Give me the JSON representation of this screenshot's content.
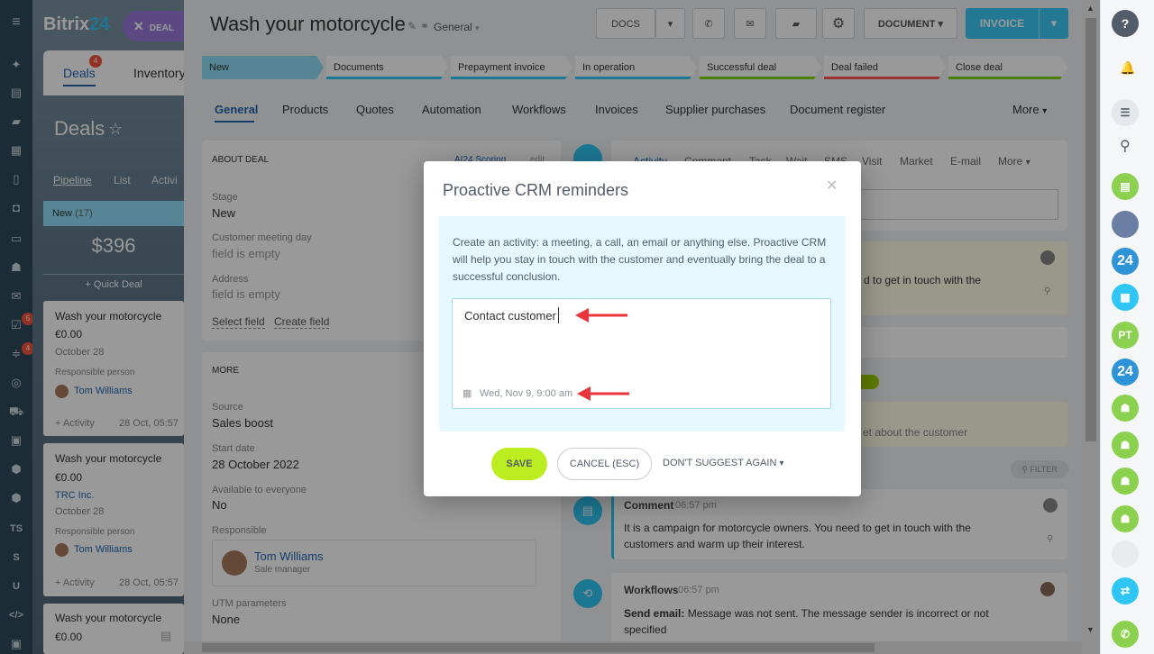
{
  "app": {
    "logo_text": "Bitrix",
    "logo_num": "24",
    "deal_chip": "DEAL"
  },
  "left_nav": {
    "badges": [
      "5",
      "4"
    ],
    "letters": [
      "TS",
      "S",
      "U"
    ]
  },
  "deals_panel": {
    "tab_deals": "Deals",
    "tab_deals_badge": "4",
    "tab_inventory": "Inventory",
    "title": "Deals",
    "view_pipeline": "Pipeline",
    "view_list": "List",
    "view_activity": "Activi",
    "column_name": "New",
    "column_count": "(17)",
    "column_total": "$396",
    "quick_deal": "+ Quick Deal",
    "cards": [
      {
        "title": "Wash your motorcycle",
        "amount": "€0.00",
        "company": "",
        "date": "October 28",
        "resp_label": "Responsible person",
        "resp": "Tom Williams",
        "activity": "+ Activity",
        "time": "28 Oct, 05:57"
      },
      {
        "title": "Wash your motorcycle",
        "amount": "€0.00",
        "company": "TRC Inc.",
        "date": "October 28",
        "resp_label": "Responsible person",
        "resp": "Tom Williams",
        "activity": "+ Activity",
        "time": "28 Oct, 05:57"
      },
      {
        "title": "Wash your motorcycle",
        "amount": "€0.00"
      }
    ]
  },
  "header": {
    "title": "Wash your motorcycle",
    "category": "General",
    "docs": "DOCS",
    "document": "DOCUMENT",
    "invoice": "INVOICE"
  },
  "stages": [
    "New",
    "Documents",
    "Prepayment invoice",
    "In operation",
    "Successful deal",
    "Deal failed",
    "Close deal"
  ],
  "tabs": [
    "General",
    "Products",
    "Quotes",
    "Automation",
    "Workflows",
    "Invoices",
    "Supplier purchases",
    "Document register",
    "More"
  ],
  "about": {
    "heading": "ABOUT DEAL",
    "scoring": "AI24 Scoring",
    "edit": "edit",
    "stage_label": "Stage",
    "stage_value": "New",
    "meeting_label": "Customer meeting day",
    "meeting_value": "field is empty",
    "address_label": "Address",
    "address_value": "field is empty",
    "select_field": "Select field",
    "create_field": "Create field"
  },
  "more": {
    "heading": "MORE",
    "source_label": "Source",
    "source_value": "Sales boost",
    "start_label": "Start date",
    "start_value": "28 October 2022",
    "avail_label": "Available to everyone",
    "avail_value": "No",
    "resp_label": "Responsible",
    "resp_name": "Tom Williams",
    "resp_role": "Sale manager",
    "utm_label": "UTM parameters",
    "utm_value": "None"
  },
  "timeline": {
    "tabs": [
      "Activity",
      "Comment",
      "Task",
      "Wait",
      "SMS",
      "Visit",
      "Market",
      "E-mail",
      "More"
    ],
    "note_partial": "d to get in touch with the",
    "note2_partial": "et about the customer",
    "filter": "FILTER",
    "comment_title": "Comment",
    "comment_time": "06:57 pm",
    "comment_text": "It is a campaign for motorcycle owners. You need to get in touch with the customers and warm up their interest.",
    "wf_title": "Workflows",
    "wf_time": "06:57 pm",
    "wf_label": "Send email:",
    "wf_text": "Message was not sent. The message sender is incorrect or not specified"
  },
  "modal": {
    "title": "Proactive CRM reminders",
    "description": "Create an activity: a meeting, a call, an email or anything else. Proactive CRM will help you stay in touch with the customer and eventually bring the deal to a successful conclusion.",
    "input_value": "Contact customer",
    "date": "Wed, Nov 9, 9:00 am",
    "save": "SAVE",
    "cancel": "CANCEL (ESC)",
    "dont_suggest": "DON'T SUGGEST AGAIN"
  },
  "right_bar": {
    "help": "?",
    "pt": "PT",
    "b24": "24"
  },
  "colors": {
    "accent": "#2fc6f6",
    "save": "#bbed21",
    "arrow": "#e8343a",
    "sidebar": "#2f4a5c"
  }
}
